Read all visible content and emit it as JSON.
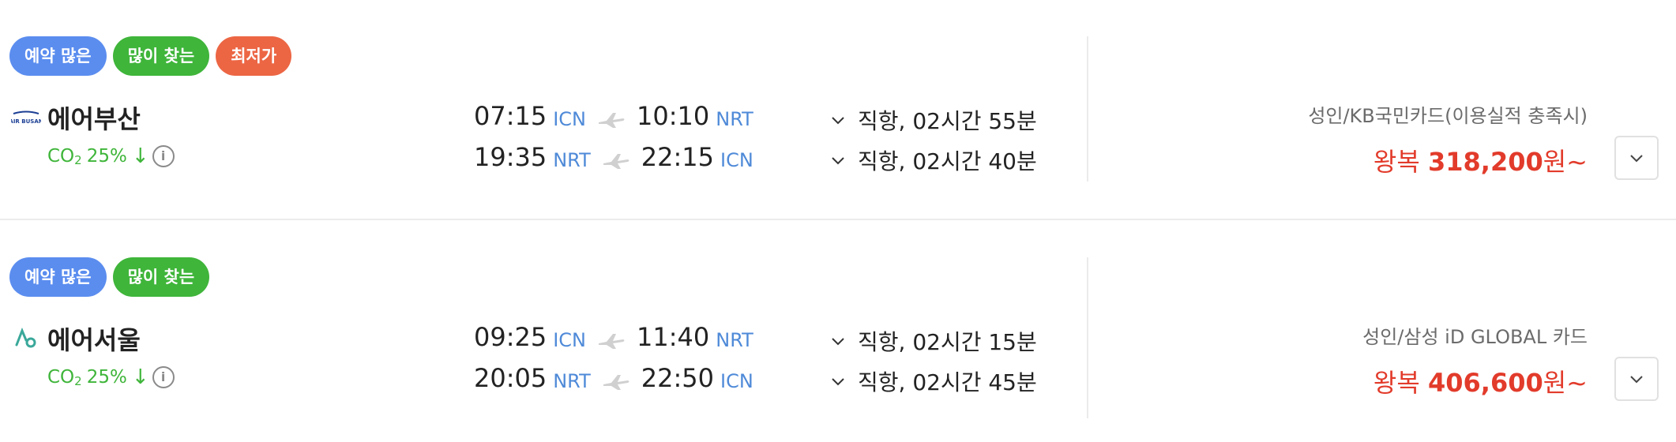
{
  "flights": [
    {
      "badges": [
        "예약 많은",
        "많이 찾는",
        "최저가"
      ],
      "airline": "에어부산",
      "airline_logo_text": "AIR BUSAN",
      "co2_prefix": "CO",
      "co2_sub": "2",
      "co2_value": "25%",
      "co2_arrow": "↓",
      "info_glyph": "i",
      "legs": [
        {
          "dep_time": "07:15",
          "dep_code": "ICN",
          "arr_time": "10:10",
          "arr_code": "NRT",
          "duration": "직항, 02시간 55분"
        },
        {
          "dep_time": "19:35",
          "dep_code": "NRT",
          "arr_time": "22:15",
          "arr_code": "ICN",
          "duration": "직항, 02시간 40분"
        }
      ],
      "card_condition": "성인/KB국민카드(이용실적 충족시)",
      "price_prefix": "왕복 ",
      "price_amount": "318,200",
      "price_suffix": "원~"
    },
    {
      "badges": [
        "예약 많은",
        "많이 찾는"
      ],
      "airline": "에어서울",
      "co2_prefix": "CO",
      "co2_sub": "2",
      "co2_value": "25%",
      "co2_arrow": "↓",
      "info_glyph": "i",
      "legs": [
        {
          "dep_time": "09:25",
          "dep_code": "ICN",
          "arr_time": "11:40",
          "arr_code": "NRT",
          "duration": "직항, 02시간 15분"
        },
        {
          "dep_time": "20:05",
          "dep_code": "NRT",
          "arr_time": "22:50",
          "arr_code": "ICN",
          "duration": "직항, 02시간 45분"
        }
      ],
      "card_condition": "성인/삼성 iD GLOBAL 카드",
      "price_prefix": "왕복 ",
      "price_amount": "406,600",
      "price_suffix": "원~"
    }
  ],
  "colors": {
    "badge_blue": "#5b8def",
    "badge_green": "#3fb53a",
    "badge_red": "#ec6644",
    "co2_green": "#3fb53a",
    "airport_code": "#4f8ad8",
    "price_red": "#e23b2b"
  },
  "icons": [
    "air-busan-logo",
    "air-seoul-logo",
    "info-icon",
    "plane-icon",
    "chevron-down-icon"
  ]
}
